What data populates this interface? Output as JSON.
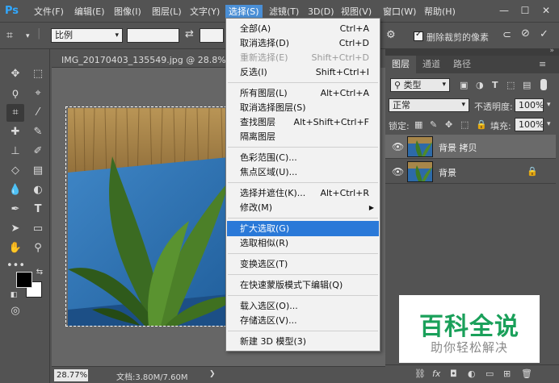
{
  "app": {
    "logo": "Ps"
  },
  "menubar": {
    "items": [
      "文件(F)",
      "编辑(E)",
      "图像(I)",
      "图层(L)",
      "文字(Y)",
      "选择(S)",
      "滤镜(T)",
      "3D(D)",
      "视图(V)",
      "窗口(W)",
      "帮助(H)"
    ],
    "active_index": 5,
    "window_controls": {
      "minimize": "—",
      "maximize": "☐",
      "close": "✕"
    }
  },
  "options_bar": {
    "ratio_value": "比例",
    "delete_cropped_label": "删除裁剪的像素",
    "delete_cropped_checked": true
  },
  "document": {
    "tab_title": "IMG_20170403_135549.jpg @ 28.8%(背景",
    "zoom": "28.77%",
    "doc_info": "文档:3.80M/7.60M"
  },
  "select_menu": {
    "items": [
      {
        "label": "全部(A)",
        "shortcut": "Ctrl+A",
        "state": "normal"
      },
      {
        "label": "取消选择(D)",
        "shortcut": "Ctrl+D",
        "state": "normal"
      },
      {
        "label": "重新选择(E)",
        "shortcut": "Shift+Ctrl+D",
        "state": "disabled"
      },
      {
        "label": "反选(I)",
        "shortcut": "Shift+Ctrl+I",
        "state": "normal"
      },
      {
        "label": "所有图层(L)",
        "shortcut": "Alt+Ctrl+A",
        "state": "normal"
      },
      {
        "label": "取消选择图层(S)",
        "shortcut": "",
        "state": "normal"
      },
      {
        "label": "查找图层",
        "shortcut": "Alt+Shift+Ctrl+F",
        "state": "normal"
      },
      {
        "label": "隔离图层",
        "shortcut": "",
        "state": "normal"
      },
      {
        "label": "色彩范围(C)...",
        "shortcut": "",
        "state": "normal"
      },
      {
        "label": "焦点区域(U)...",
        "shortcut": "",
        "state": "normal"
      },
      {
        "label": "选择并遮住(K)...",
        "shortcut": "Alt+Ctrl+R",
        "state": "normal"
      },
      {
        "label": "修改(M)",
        "shortcut": "",
        "state": "submenu"
      },
      {
        "label": "扩大选取(G)",
        "shortcut": "",
        "state": "highlighted"
      },
      {
        "label": "选取相似(R)",
        "shortcut": "",
        "state": "normal"
      },
      {
        "label": "变换选区(T)",
        "shortcut": "",
        "state": "normal"
      },
      {
        "label": "在快速蒙版模式下编辑(Q)",
        "shortcut": "",
        "state": "normal"
      },
      {
        "label": "载入选区(O)...",
        "shortcut": "",
        "state": "normal"
      },
      {
        "label": "存储选区(V)...",
        "shortcut": "",
        "state": "normal"
      },
      {
        "label": "新建 3D 模型(3)",
        "shortcut": "",
        "state": "normal"
      }
    ]
  },
  "layers_panel": {
    "tabs": [
      "图层",
      "通道",
      "路径"
    ],
    "active_tab": 0,
    "filter_kind": "类型",
    "blend_mode": "正常",
    "opacity_label": "不透明度:",
    "opacity_value": "100%",
    "lock_label": "锁定:",
    "fill_label": "填充:",
    "fill_value": "100%",
    "layers": [
      {
        "name": "背景 拷贝",
        "selected": true,
        "locked": false
      },
      {
        "name": "背景",
        "selected": false,
        "locked": true
      }
    ]
  },
  "watermark": {
    "title": "百科全说",
    "subtitle": "助你轻松解决"
  },
  "colors": {
    "ui_dark": "#535353",
    "menu_highlight": "#2a79d8",
    "selected_layer": "#6a6a6a",
    "watermark_green": "#1aa05a"
  }
}
